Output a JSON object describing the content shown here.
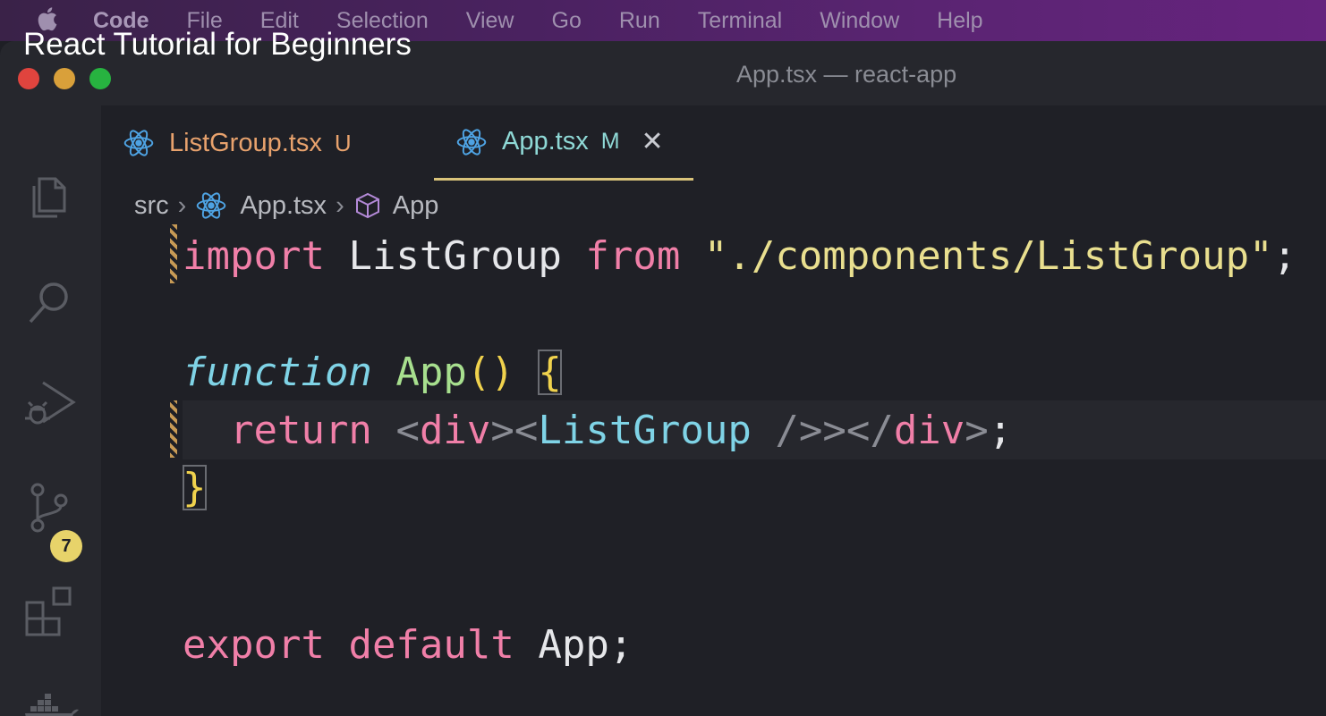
{
  "menubar": {
    "items": [
      "Code",
      "File",
      "Edit",
      "Selection",
      "View",
      "Go",
      "Run",
      "Terminal",
      "Window",
      "Help"
    ]
  },
  "video_title": "React Tutorial for Beginners",
  "window": {
    "title": "App.tsx — react-app"
  },
  "activity_bar": {
    "icons": [
      "explorer-icon",
      "search-icon",
      "run-debug-icon",
      "source-control-icon",
      "extensions-icon",
      "docker-icon"
    ],
    "source_control_badge": "7"
  },
  "tabs": [
    {
      "label": "ListGroup.tsx",
      "status": "U",
      "active": false
    },
    {
      "label": "App.tsx",
      "status": "M",
      "active": true
    }
  ],
  "breadcrumb": {
    "folder": "src",
    "file": "App.tsx",
    "symbol": "App"
  },
  "code": {
    "line1": {
      "kw": "import",
      "ident": "ListGroup",
      "kw2": "from",
      "str": "\"./components/ListGroup\"",
      "end": ";"
    },
    "line2": {
      "kw": "function",
      "name": "App",
      "parens": "()",
      "brace": "{"
    },
    "line3": {
      "kw": "return",
      "lt1": "<",
      "tag1": "div",
      "gt1": ">",
      "lt2": "<",
      "comp": "ListGroup",
      "selfclose": " />",
      "lt3": "</",
      "tag2": "div",
      "gt2": ">",
      "end": ";"
    },
    "line4": {
      "brace": "}"
    },
    "line5": {
      "kw": "export",
      "kw2": "default",
      "ident": "App",
      "end": ";"
    }
  },
  "colors": {
    "keyword_pink": "#f07fa8",
    "keyword_italic": "#7fd3e6",
    "function_name": "#a7df8e",
    "string": "#e9df8f",
    "brace": "#f0d24d",
    "untracked_tab": "#e8a26d",
    "modified_tab": "#8fd9d6"
  }
}
